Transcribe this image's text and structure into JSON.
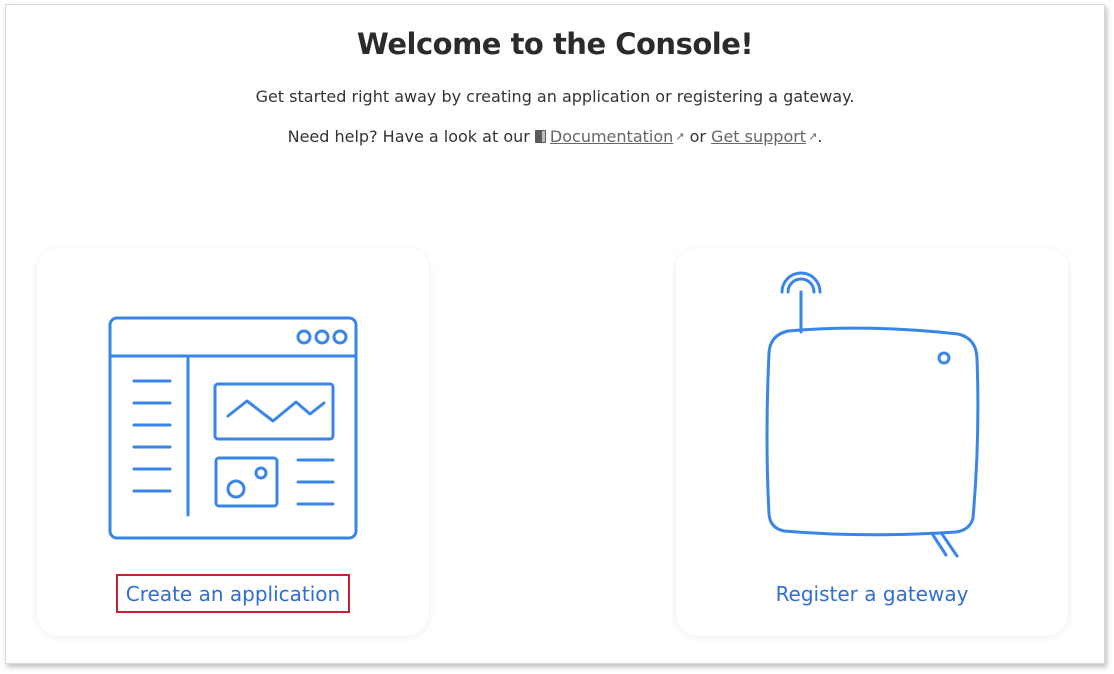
{
  "welcome": {
    "title": "Welcome to the Console!",
    "subtitle": "Get started right away by creating an application or registering a gateway.",
    "help_prefix": "Need help? Have a look at our",
    "documentation_label": "Documentation",
    "or_text": "or",
    "support_label": "Get support",
    "period": "."
  },
  "cards": {
    "application": {
      "label": "Create an application",
      "icon": "application-dashboard-icon",
      "focused": true
    },
    "gateway": {
      "label": "Register a gateway",
      "icon": "gateway-device-icon"
    }
  },
  "colors": {
    "accent": "#2e6fcf",
    "illustration": "#3a86e8",
    "focus_outline": "#c8202f"
  }
}
